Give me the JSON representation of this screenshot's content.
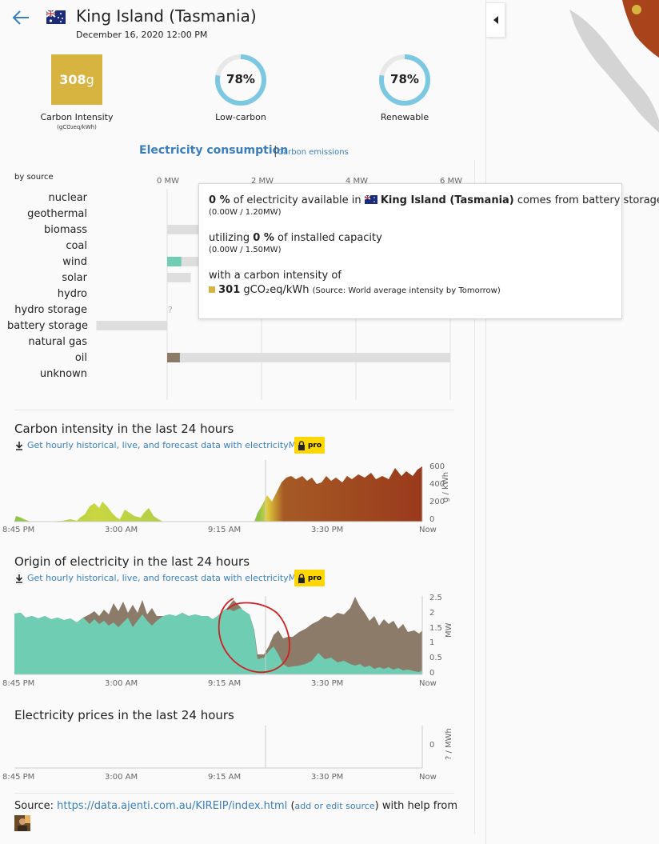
{
  "header": {
    "zone_name": "King Island (Tasmania)",
    "datetime": "December 16, 2020 12:00 PM",
    "back_icon": "arrow-left-icon",
    "flag_icon": "australia-flag-icon",
    "collapse_icon": "caret-left-icon"
  },
  "kpis": {
    "carbon_intensity_value": "308",
    "carbon_intensity_unit": "g",
    "carbon_intensity_label": "Carbon Intensity",
    "carbon_intensity_sublabel": "(gCO₂eq/kWh)",
    "low_carbon_value": "78%",
    "low_carbon_fraction": 0.78,
    "low_carbon_label": "Low-carbon",
    "renewable_value": "78%",
    "renewable_fraction": 0.78,
    "renewable_label": "Renewable",
    "ci_color": "#d7b440",
    "ring_color": "#7cc8e3"
  },
  "tabs": {
    "active": "Electricity consumption",
    "separator": "|",
    "inactive": "Carbon emissions"
  },
  "source_chart": {
    "by_source_label": "by source",
    "axis_ticks": [
      "0 MW",
      "2 MW",
      "4 MW",
      "6 MW"
    ],
    "unknown_mark": "?",
    "rows": [
      {
        "name": "nuclear",
        "capacity": 0,
        "production": 0
      },
      {
        "name": "geothermal",
        "capacity": 0,
        "production": 0
      },
      {
        "name": "biomass",
        "capacity": 0.7,
        "production": 0
      },
      {
        "name": "coal",
        "capacity": 0,
        "production": 0
      },
      {
        "name": "wind",
        "capacity": 1.5,
        "production": 0.3
      },
      {
        "name": "solar",
        "capacity": 0.5,
        "production": 0
      },
      {
        "name": "hydro",
        "capacity": 0,
        "production": 0
      },
      {
        "name": "hydro storage",
        "capacity": 0,
        "production": 0
      },
      {
        "name": "battery storage",
        "capacity": 1.5,
        "production": 0,
        "negative_capacity": 1.5
      },
      {
        "name": "natural gas",
        "capacity": 0,
        "production": 0
      },
      {
        "name": "oil",
        "capacity": 6.0,
        "production": 0.27
      },
      {
        "name": "unknown",
        "capacity": 0,
        "production": 0
      }
    ]
  },
  "tooltip": {
    "l1_pct": "0 %",
    "l1_text": "of electricity available in",
    "l1_zone": "King Island (Tasmania)",
    "l1_tail": "comes from battery storage",
    "l1_sub": "(0.00W / 1.20MW)",
    "l2_pre": "utilizing",
    "l2_pct": "0 %",
    "l2_tail": "of installed capacity",
    "l2_sub": "(0.00W / 1.50MW)",
    "l3_text": "with a carbon intensity of",
    "l3_value": "301",
    "l3_unit": "gCO₂eq/kWh",
    "l3_source": "(Source: World average intensity by Tomorrow)"
  },
  "ci_history": {
    "title": "Carbon intensity in the last 24 hours",
    "api_link": "Get hourly historical, live, and forecast data with electricityMap API",
    "pro_label": "pro",
    "y_ticks": [
      "600",
      "400",
      "200",
      "0"
    ],
    "y_unit": "g / kWh",
    "x_ticks": [
      "8:45 PM",
      "3:00 AM",
      "9:15 AM",
      "3:30 PM",
      "Now"
    ]
  },
  "origin_history": {
    "title": "Origin of electricity in the last 24 hours",
    "api_link": "Get hourly historical, live, and forecast data with electricityMap API",
    "pro_label": "pro",
    "y_ticks": [
      "2.5",
      "2",
      "1.5",
      "1",
      "0.5",
      "0"
    ],
    "y_unit": "MW",
    "x_ticks": [
      "8:45 PM",
      "3:00 AM",
      "9:15 AM",
      "3:30 PM",
      "Now"
    ],
    "wind_color": "#6fcdb4",
    "oil_color": "#8c7b68"
  },
  "price_history": {
    "title": "Electricity prices in the last 24 hours",
    "y_ticks": [
      "0"
    ],
    "y_unit": "? / MWh",
    "x_ticks": [
      "8:45 PM",
      "3:00 AM",
      "9:15 AM",
      "3:30 PM",
      "Now"
    ]
  },
  "footer": {
    "source_prefix": "Source:",
    "source_url": "https://data.ajenti.com.au/KIREIP/index.html",
    "open_paren": "(",
    "edit_link": "add or edit source",
    "close_paren": ")",
    "help_text": "with help from"
  }
}
